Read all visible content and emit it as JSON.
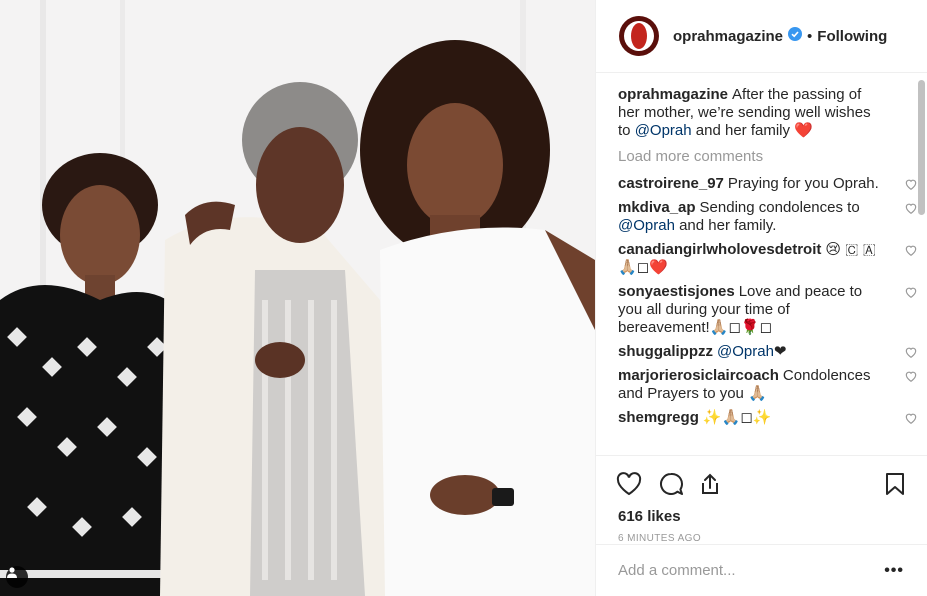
{
  "header": {
    "username": "oprahmagazine",
    "separator": "•",
    "follow_state": "Following"
  },
  "caption": {
    "author": "oprahmagazine",
    "text_before": "After the passing of her mother, we’re sending well wishes to",
    "mention": "@Oprah",
    "text_after": "and her family ❤️"
  },
  "load_more": "Load more comments",
  "comments": [
    {
      "author": "castroirene_97",
      "text": "Praying for you Oprah."
    },
    {
      "author": "mkdiva_ap",
      "text": "Sending condolences to",
      "mention": "@Oprah",
      "after": "and her family."
    },
    {
      "author": "canadiangirlwholovesdetroit",
      "text": "😢 🇨 🇦 🙏🏼◻❤️"
    },
    {
      "author": "sonyaestisjones",
      "text": "Love and peace to you all during your time of bereavement!🙏🏼◻🌹◻"
    },
    {
      "author": "shuggalippzz",
      "text": "",
      "mention": "@Oprah",
      "after": "❤"
    },
    {
      "author": "marjorierosiclaircoach",
      "text": "Condolences and Prayers to you 🙏🏼"
    },
    {
      "author": "shemgregg",
      "text": "✨🙏🏼◻✨"
    }
  ],
  "likes": "616 likes",
  "timestamp": "6 MINUTES AGO",
  "add_comment_placeholder": "Add a comment...",
  "more_options": "•••",
  "icons": [
    "heart-icon",
    "comment-icon",
    "share-icon",
    "bookmark-icon",
    "verified-badge-icon",
    "user-tag-icon"
  ],
  "colors": {
    "verified": "#3897f0",
    "link": "#003569",
    "muted": "#999999",
    "brand": "#c3251d"
  }
}
